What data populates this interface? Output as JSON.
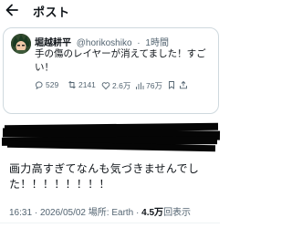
{
  "header": {
    "title": "ポスト"
  },
  "quoted_post": {
    "author_name": "堀越耕平",
    "handle": "@horikoshiko",
    "separator": "·",
    "time_ago": "1時間",
    "text": "手の傷のレイヤーが消えてました！すごい！",
    "metrics": {
      "replies": "529",
      "reposts": "2141",
      "likes": "2.6万",
      "views": "76万"
    }
  },
  "post": {
    "text": "画力高すぎてなんも気づきませんでした！！！！！！！！",
    "time": "16:31",
    "date": "2026/05/02",
    "location_label": "場所: Earth",
    "views_count": "4.5万",
    "views_suffix": "回表示",
    "dot": "·"
  },
  "icons": {
    "back": "back-arrow-icon",
    "reply": "reply-icon",
    "repost": "repost-icon",
    "like": "heart-icon",
    "views": "views-icon",
    "bookmark": "bookmark-icon",
    "share": "share-icon"
  }
}
